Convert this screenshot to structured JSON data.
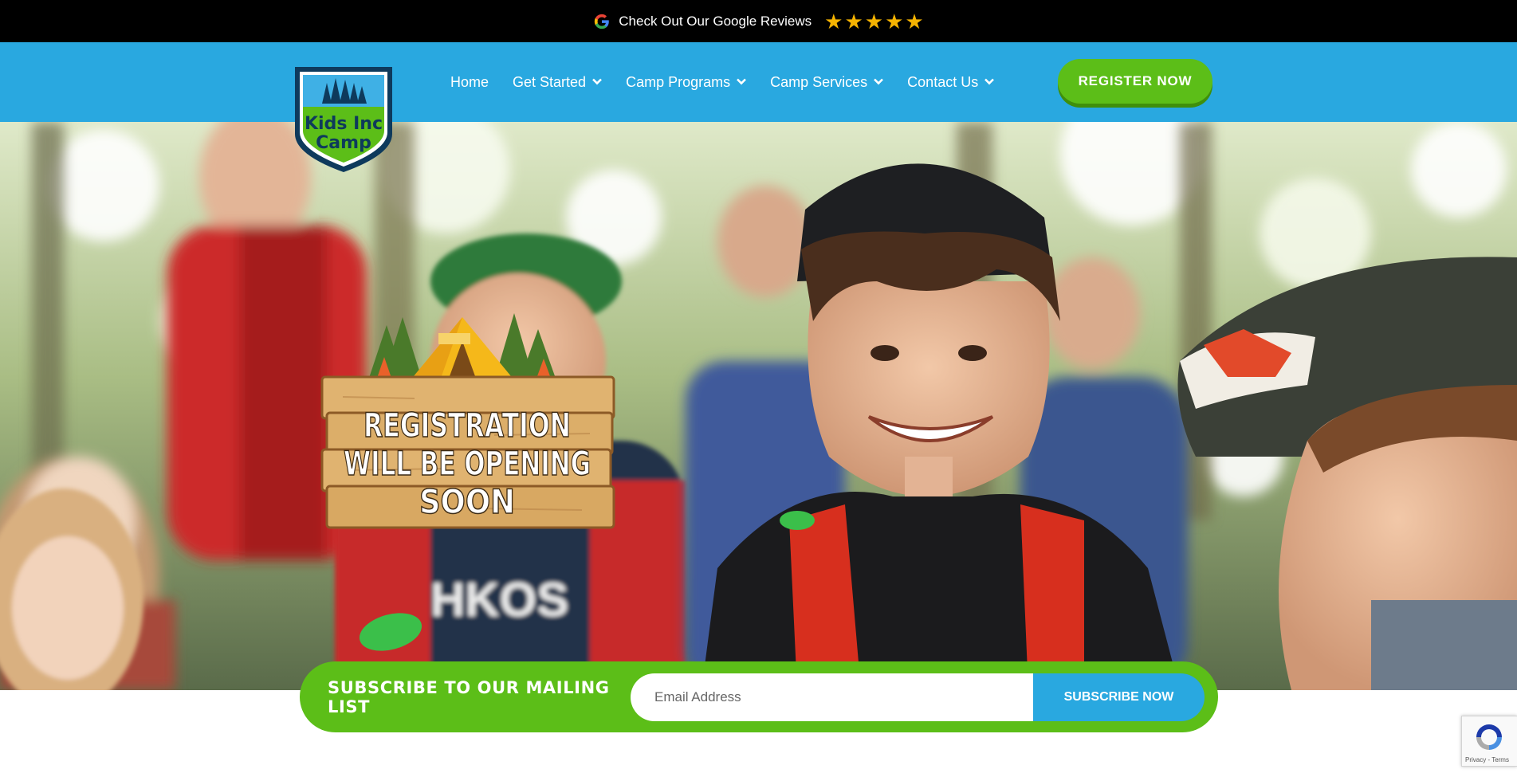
{
  "topbar": {
    "reviews_text": "Check Out Our Google Reviews",
    "rating": 5,
    "stars": [
      "★",
      "★",
      "★",
      "★",
      "★"
    ],
    "star_color": "#f5b301",
    "icon": "google-icon"
  },
  "header": {
    "logo_text_line1": "Kids Inc",
    "logo_text_line2": "Camp",
    "nav": [
      {
        "label": "Home",
        "dropdown": false
      },
      {
        "label": "Get Started",
        "dropdown": true
      },
      {
        "label": "Camp Programs",
        "dropdown": true
      },
      {
        "label": "Camp Services",
        "dropdown": true
      },
      {
        "label": "Contact Us",
        "dropdown": true
      }
    ],
    "register_label": "REGISTER NOW",
    "bg_color": "#29a8e0",
    "accent_green": "#5cbe18"
  },
  "hero": {
    "sign_lines": [
      "REGISTRATION",
      "WILL BE OPENING",
      "SOON"
    ]
  },
  "subscribe": {
    "label": "SUBSCRIBE TO OUR MAILING LIST",
    "email_placeholder": "Email Address",
    "button_label": "SUBSCRIBE NOW"
  },
  "recaptcha": {
    "terms": "Privacy - Terms"
  }
}
